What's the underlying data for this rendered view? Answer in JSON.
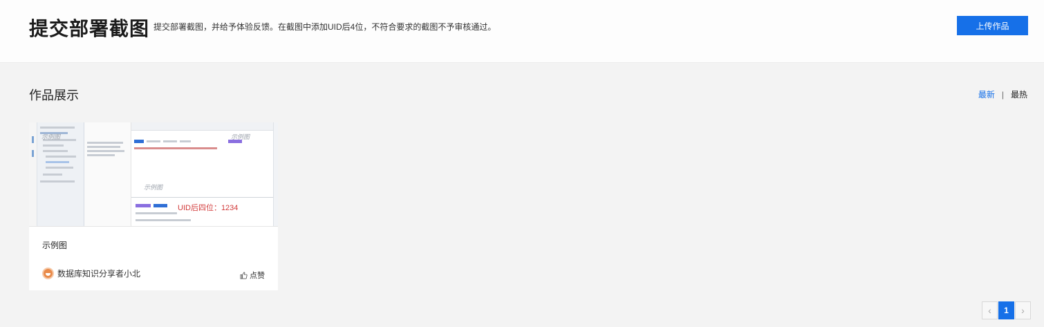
{
  "header": {
    "title": "提交部署截图",
    "subtitle": "提交部署截图，并给予体验反馈。在截图中添加UID后4位，不符合要求的截图不予审核通过。",
    "upload_label": "上传作品"
  },
  "gallery": {
    "title": "作品展示",
    "sort_latest": "最新",
    "sort_separator": "|",
    "sort_hot": "最热"
  },
  "cards": [
    {
      "name": "示例图",
      "author": "数据库知识分享者小北",
      "like_label": "点赞",
      "thumbnail": {
        "watermark": "示例图",
        "uid_text": "UID后四位：1234"
      }
    }
  ],
  "pagination": {
    "prev": "‹",
    "current": "1",
    "next": "›"
  },
  "colors": {
    "accent": "#1670e8",
    "background": "#f3f3f3"
  }
}
